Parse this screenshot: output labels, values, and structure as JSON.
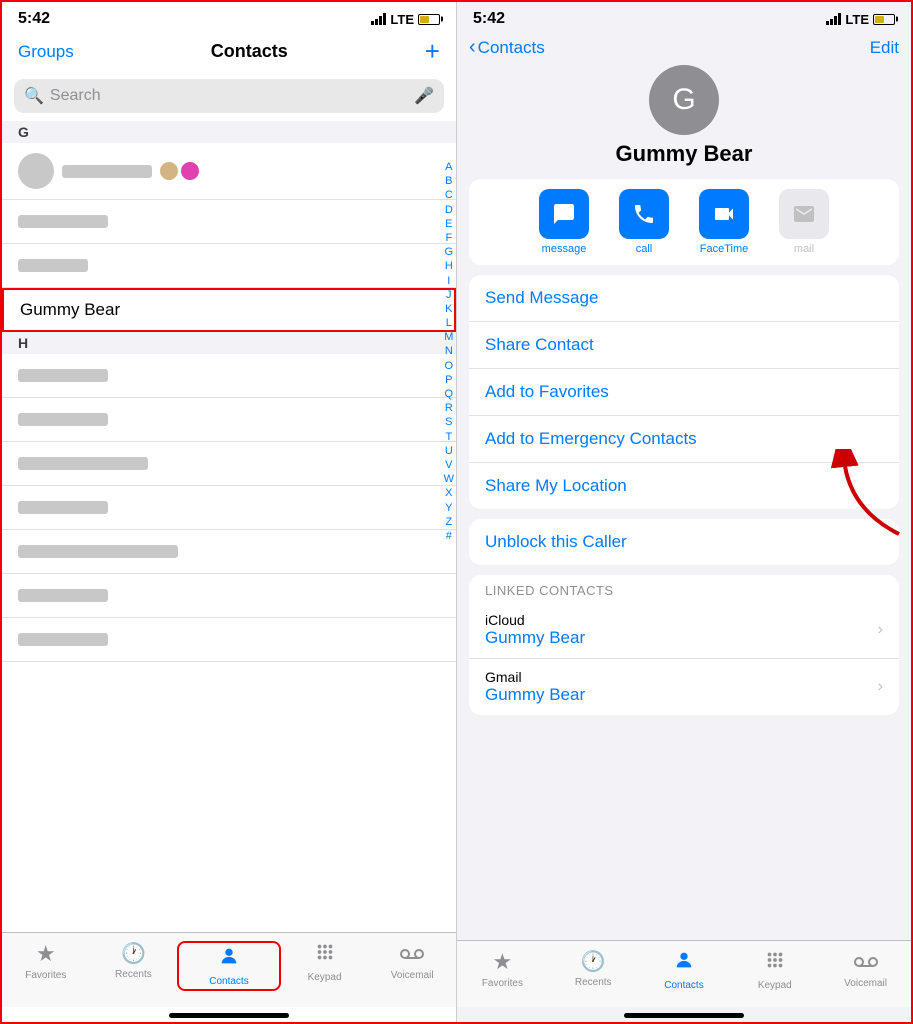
{
  "left": {
    "status": {
      "time": "5:42",
      "signal": "LTE",
      "battery": 50
    },
    "nav": {
      "groups": "Groups",
      "title": "Contacts",
      "add": "+"
    },
    "search": {
      "placeholder": "Search"
    },
    "sections": [
      {
        "letter": "G",
        "items": [
          {
            "type": "blurred-avatar-color",
            "id": "g1"
          },
          {
            "type": "blurred",
            "width": "medium",
            "id": "g2"
          },
          {
            "type": "blurred",
            "width": "short",
            "id": "g3"
          },
          {
            "type": "highlighted",
            "name": "Gummy Bear",
            "id": "gummy"
          }
        ]
      },
      {
        "letter": "H",
        "items": [
          {
            "type": "blurred",
            "width": "medium",
            "id": "h1"
          },
          {
            "type": "blurred",
            "width": "medium",
            "id": "h2"
          },
          {
            "type": "blurred",
            "width": "wide",
            "id": "h3"
          },
          {
            "type": "blurred",
            "width": "medium",
            "id": "h4"
          },
          {
            "type": "blurred",
            "width": "wide",
            "id": "h5"
          },
          {
            "type": "blurred",
            "width": "medium",
            "id": "h6"
          },
          {
            "type": "blurred",
            "width": "medium",
            "id": "h7"
          }
        ]
      }
    ],
    "alphabet": [
      "A",
      "B",
      "C",
      "D",
      "E",
      "F",
      "G",
      "H",
      "I",
      "J",
      "K",
      "L",
      "M",
      "N",
      "O",
      "P",
      "Q",
      "R",
      "S",
      "T",
      "U",
      "V",
      "W",
      "X",
      "Y",
      "Z",
      "#"
    ],
    "tabs": [
      {
        "id": "favorites",
        "label": "Favorites",
        "icon": "★",
        "active": false
      },
      {
        "id": "recents",
        "label": "Recents",
        "icon": "🕐",
        "active": false
      },
      {
        "id": "contacts",
        "label": "Contacts",
        "icon": "👤",
        "active": true
      },
      {
        "id": "keypad",
        "label": "Keypad",
        "icon": "⠿",
        "active": false
      },
      {
        "id": "voicemail",
        "label": "Voicemail",
        "icon": "⊙⊙",
        "active": false
      }
    ]
  },
  "right": {
    "status": {
      "time": "5:42",
      "signal": "LTE"
    },
    "nav": {
      "back": "Contacts",
      "edit": "Edit"
    },
    "contact": {
      "initial": "G",
      "name": "Gummy Bear"
    },
    "actions": [
      {
        "id": "message",
        "label": "message",
        "icon": "💬",
        "blue": true
      },
      {
        "id": "call",
        "label": "call",
        "icon": "📞",
        "blue": true
      },
      {
        "id": "facetime",
        "label": "FaceTime",
        "icon": "📹",
        "blue": true
      },
      {
        "id": "mail",
        "label": "mail",
        "icon": "✉",
        "blue": false
      }
    ],
    "menu_items": [
      {
        "id": "send-message",
        "text": "Send Message"
      },
      {
        "id": "share-contact",
        "text": "Share Contact"
      },
      {
        "id": "add-favorites",
        "text": "Add to Favorites"
      },
      {
        "id": "add-emergency",
        "text": "Add to Emergency Contacts"
      },
      {
        "id": "share-location",
        "text": "Share My Location"
      }
    ],
    "unblock": {
      "text": "Unblock this Caller"
    },
    "linked": {
      "header": "LINKED CONTACTS",
      "items": [
        {
          "id": "icloud",
          "provider": "iCloud",
          "name": "Gummy Bear"
        },
        {
          "id": "gmail",
          "provider": "Gmail",
          "name": "Gummy Bear"
        }
      ]
    },
    "tabs": [
      {
        "id": "favorites",
        "label": "Favorites",
        "icon": "★",
        "active": false
      },
      {
        "id": "recents",
        "label": "Recents",
        "icon": "🕐",
        "active": false
      },
      {
        "id": "contacts",
        "label": "Contacts",
        "icon": "👤",
        "active": true
      },
      {
        "id": "keypad",
        "label": "Keypad",
        "icon": "⠿",
        "active": false
      },
      {
        "id": "voicemail",
        "label": "Voicemail",
        "icon": "⊙⊙",
        "active": false
      }
    ]
  }
}
